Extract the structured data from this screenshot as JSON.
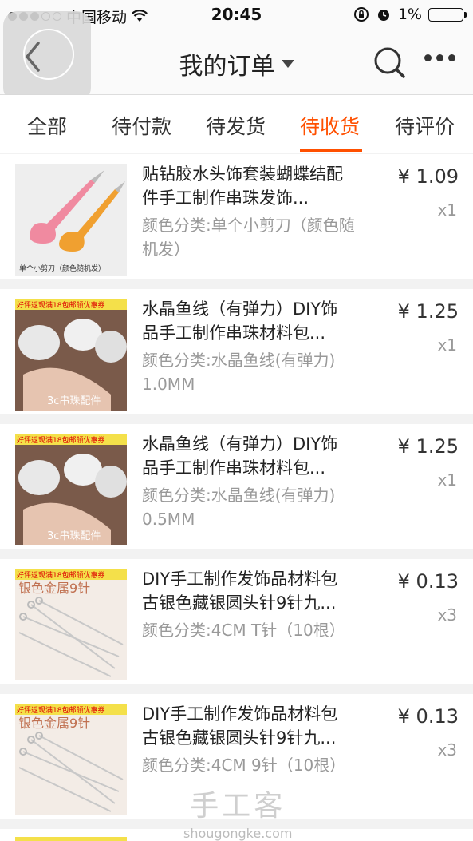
{
  "status_bar": {
    "carrier": "中国移动",
    "time": "20:45",
    "battery": "1%"
  },
  "nav": {
    "title": "我的订单",
    "back_icon": "chevron-left-icon",
    "search_icon": "search-icon",
    "more_icon": "more-icon"
  },
  "tabs": [
    {
      "label": "全部"
    },
    {
      "label": "待付款"
    },
    {
      "label": "待发货"
    },
    {
      "label": "待收货"
    },
    {
      "label": "待评价"
    }
  ],
  "active_tab": "待收货",
  "colors": {
    "accent": "#ff5000"
  },
  "orders": [
    {
      "name": "贴钻胶水头饰套装蝴蝶结配件手工制作串珠发饰...",
      "spec": "颜色分类:单个小剪刀（颜色随机发）",
      "price": "¥ 1.09",
      "qty": "x1",
      "thumb_caption": "单个小剪刀（颜色随机发）"
    },
    {
      "name": "水晶鱼线（有弹力）DIY饰品手工制作串珠材料包...",
      "spec": "颜色分类:水晶鱼线(有弹力) 1.0MM",
      "price": "¥ 1.25",
      "qty": "x1",
      "thumb_badge": "好评返现满18包邮领优惠券",
      "thumb_caption": "3c串珠配件"
    },
    {
      "name": "水晶鱼线（有弹力）DIY饰品手工制作串珠材料包...",
      "spec": "颜色分类:水晶鱼线(有弹力) 0.5MM",
      "price": "¥ 1.25",
      "qty": "x1",
      "thumb_badge": "好评返现满18包邮领优惠券",
      "thumb_caption": "3c串珠配件"
    },
    {
      "name": "DIY手工制作发饰品材料包古银色藏银圆头针9针九...",
      "spec": "颜色分类:4CM T针（10根）",
      "price": "¥ 0.13",
      "qty": "x3",
      "thumb_badge": "好评返现满18包邮领优惠券",
      "thumb_caption": "银色金属9针"
    },
    {
      "name": "DIY手工制作发饰品材料包古银色藏银圆头针9针九...",
      "spec": "颜色分类:4CM 9针（10根）",
      "price": "¥ 0.13",
      "qty": "x3",
      "thumb_badge": "好评返现满18包邮领优惠券",
      "thumb_caption": "银色金属9针"
    }
  ],
  "watermark": {
    "title": "手工客",
    "site": "shougongke.com"
  }
}
